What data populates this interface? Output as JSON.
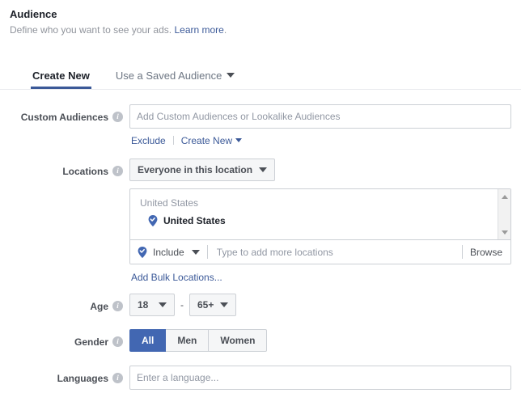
{
  "header": {
    "title": "Audience",
    "subtitle_text": "Define who you want to see your ads.",
    "subtitle_link": "Learn more",
    "subtitle_period": "."
  },
  "tabs": [
    {
      "label": "Create New",
      "active": true
    },
    {
      "label": "Use a Saved Audience",
      "active": false
    }
  ],
  "custom_audiences": {
    "label": "Custom Audiences",
    "placeholder": "Add Custom Audiences or Lookalike Audiences",
    "value": "",
    "exclude_link": "Exclude",
    "create_new_link": "Create New"
  },
  "locations": {
    "label": "Locations",
    "scope_button": "Everyone in this location",
    "group_header": "United States",
    "selected_items": [
      {
        "name": "United States",
        "icon": "map-pin-check-icon"
      }
    ],
    "include_label": "Include",
    "typeahead_placeholder": "Type to add more locations",
    "typeahead_value": "",
    "browse_label": "Browse",
    "bulk_link": "Add Bulk Locations..."
  },
  "age": {
    "label": "Age",
    "min": "18",
    "max": "65+",
    "separator": "-"
  },
  "gender": {
    "label": "Gender",
    "options": [
      "All",
      "Men",
      "Women"
    ],
    "selected": "All"
  },
  "languages": {
    "label": "Languages",
    "placeholder": "Enter a language...",
    "value": ""
  },
  "colors": {
    "brand_blue": "#3b5998",
    "selected_blue": "#4267b2",
    "link_blue": "#3b5998",
    "text_dark": "#1d2129",
    "text_muted": "#90949c",
    "border": "#ccd0d5"
  }
}
